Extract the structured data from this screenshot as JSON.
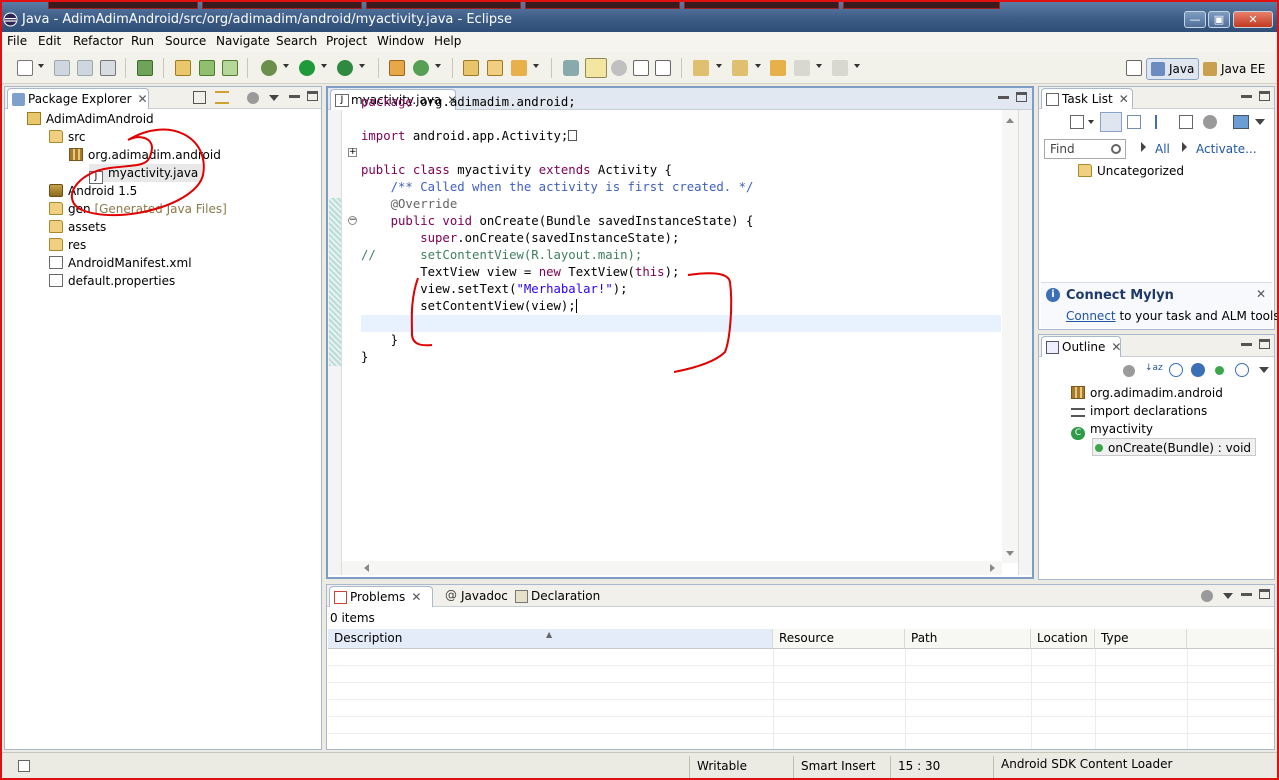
{
  "window": {
    "title": "Java - AdimAdimAndroid/src/org/adimadim/android/myactivity.java - Eclipse",
    "min_glyph": "—",
    "max_glyph": "▣",
    "close_glyph": "✕"
  },
  "menu": [
    "File",
    "Edit",
    "Refactor",
    "Run",
    "Source",
    "Navigate",
    "Search",
    "Project",
    "Window",
    "Help"
  ],
  "perspectives": {
    "java": "Java",
    "java_ee": "Java EE"
  },
  "package_explorer": {
    "tab": "Package Explorer",
    "close": "✕",
    "tree": {
      "project": "AdimAdimAndroid",
      "src": "src",
      "package": "org.adimadim.android",
      "file": "myactivity.java",
      "android_lib": "Android 1.5",
      "gen": "gen",
      "gen_note": "[Generated Java Files]",
      "assets": "assets",
      "res": "res",
      "manifest": "AndroidManifest.xml",
      "properties": "default.properties"
    }
  },
  "editor": {
    "tab": "myactivity.java",
    "close": "✕",
    "lines": {
      "l1_kw": "package",
      "l1_rest": " org.adimadim.android;",
      "l3_kw": "import",
      "l3_rest": " android.app.Activity;",
      "l5_kw1": "public class",
      "l5_mid": " myactivity ",
      "l5_kw2": "extends",
      "l5_rest": " Activity {",
      "l6": "    /** Called when the activity is first created. */",
      "l7": "    @Override",
      "l8_kw": "    public void",
      "l8_rest": " onCreate(Bundle savedInstanceState) {",
      "l9_kw": "        super",
      "l9_rest": ".onCreate(savedInstanceState);",
      "l10": "//      setContentView(R.layout.main);",
      "l11_a": "        TextView view = ",
      "l11_kw1": "new",
      "l11_b": " TextView(",
      "l11_kw2": "this",
      "l11_c": ");",
      "l12_a": "        view.setText(",
      "l12_str": "\"Merhabalar!\"",
      "l12_c": ");",
      "l13": "        setContentView(view);",
      "l15": "    }",
      "l16": "}"
    }
  },
  "task_list": {
    "tab": "Task List",
    "close": "✕",
    "find_placeholder": "Find",
    "filter_all": "All",
    "filter_activate": "Activate...",
    "category": "Uncategorized",
    "mylyn_title": "Connect Mylyn",
    "mylyn_link": "Connect",
    "mylyn_rest": " to your task and ALM tools."
  },
  "outline": {
    "tab": "Outline",
    "close": "✕",
    "items": [
      "org.adimadim.android",
      "import declarations",
      "myactivity",
      "onCreate(Bundle) : void"
    ]
  },
  "problems": {
    "tabs": [
      "Problems",
      "Javadoc",
      "Declaration"
    ],
    "close": "✕",
    "count": "0 items",
    "columns": [
      "Description",
      "Resource",
      "Path",
      "Location",
      "Type"
    ]
  },
  "status": {
    "writable": "Writable",
    "insert_mode": "Smart Insert",
    "position": "15 : 30",
    "loader": "Android SDK Content Loader"
  },
  "colors": {
    "annotation_red": "#e00000",
    "accent_blue": "#3f5fbf",
    "keyword": "#7f0055"
  }
}
